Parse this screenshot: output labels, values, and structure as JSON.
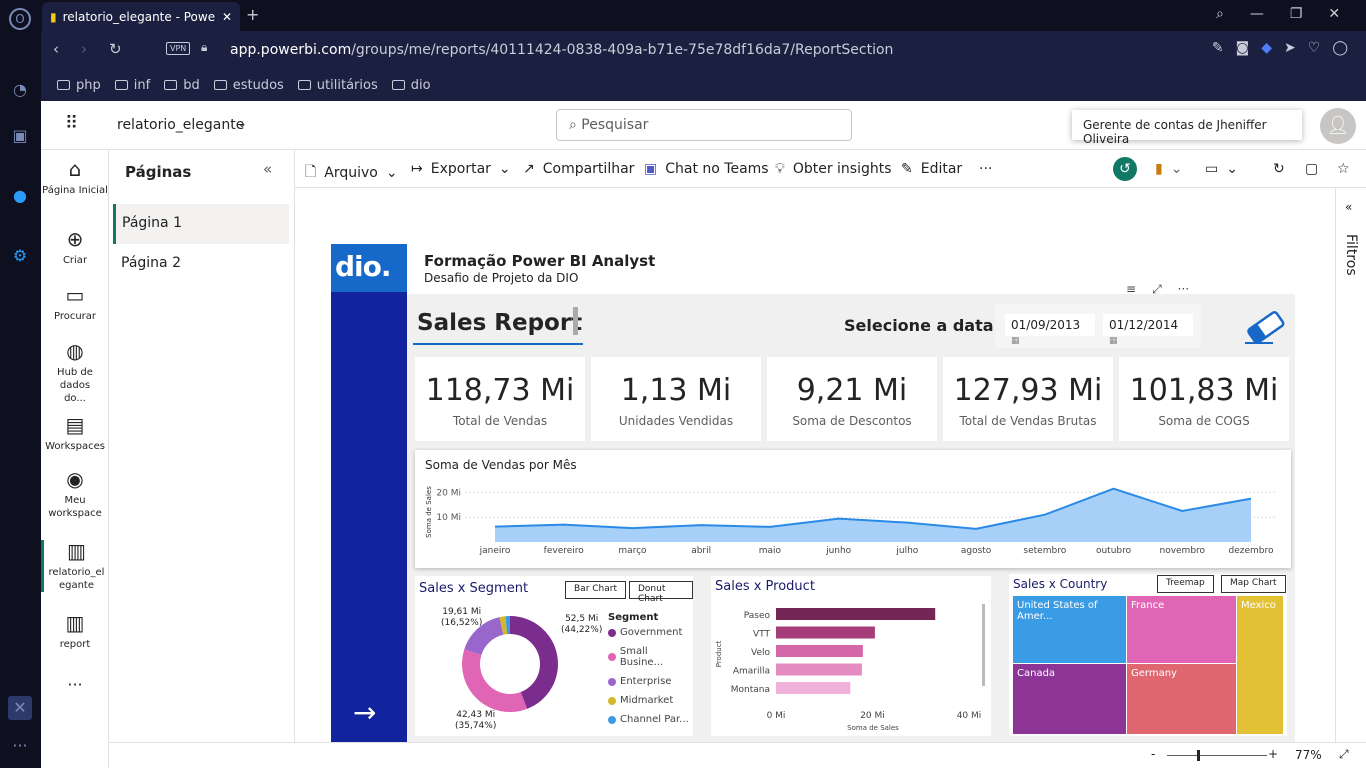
{
  "browser": {
    "tab_title": "relatorio_elegante - Power",
    "vpn": "VPN",
    "url_host": "app.powerbi.com",
    "url_path": "/groups/me/reports/40111424-0838-409a-b71e-75e78df16da7/ReportSection",
    "bookmarks": [
      "php",
      "inf",
      "bd",
      "estudos",
      "utilitários",
      "dio"
    ]
  },
  "header": {
    "report_name": "relatorio_elegante",
    "search_placeholder": "Pesquisar",
    "tooltip": "Gerente de contas de Jheniffer Oliveira"
  },
  "leftnav": [
    "Página Inicial",
    "Criar",
    "Procurar",
    "Hub de dados do...",
    "Workspaces",
    "Meu workspace",
    "relatorio_elegante",
    "report"
  ],
  "pages": {
    "title": "Páginas",
    "items": [
      "Página 1",
      "Página 2"
    ]
  },
  "toolbar": {
    "arquivo": "Arquivo",
    "exportar": "Exportar",
    "compartilhar": "Compartilhar",
    "chat": "Chat no Teams",
    "insights": "Obter insights",
    "editar": "Editar",
    "more": "···"
  },
  "filters_label": "Filtros",
  "status": {
    "zoom": "77%"
  },
  "report": {
    "title": "Formação Power BI Analyst",
    "subtitle": "Desafio de Projeto da DIO",
    "logo": "dio.",
    "sales_report": "Sales Report",
    "select_date": "Selecione a data",
    "date_from": "01/09/2013",
    "date_to": "01/12/2014",
    "kpis": [
      {
        "value": "118,73 Mi",
        "label": "Total de Vendas"
      },
      {
        "value": "1,13 Mi",
        "label": "Unidades Vendidas"
      },
      {
        "value": "9,21 Mi",
        "label": "Soma de Descontos"
      },
      {
        "value": "127,93 Mi",
        "label": "Total de Vendas Brutas"
      },
      {
        "value": "101,83 Mi",
        "label": "Soma de COGS"
      }
    ],
    "line_title": "Soma de Vendas por Mês",
    "line_ylabel": "Soma de Sales",
    "line_yticks": [
      "20 Mi",
      "10 Mi"
    ],
    "segment_title": "Sales x Segment",
    "bar_chart_btn": "Bar Chart",
    "donut_chart_btn": "Donut Chart",
    "segment_legend_title": "Segment",
    "donut_labels": {
      "top_right": "52,5 Mi",
      "top_right_pct": "(44,22%)",
      "top_left": "19,61 Mi",
      "top_left_pct": "(16,52%)",
      "bottom": "42,43 Mi",
      "bottom_pct": "(35,74%)"
    },
    "product_title": "Sales x Product",
    "product_ylabel": "Product",
    "product_xlabel": "Soma de Sales",
    "product_xticks": [
      "0 Mi",
      "20 Mi",
      "40 Mi"
    ],
    "country_title": "Sales x Country",
    "treemap_btn": "Treemap",
    "mapchart_btn": "Map Chart",
    "treemap": [
      "United States of Amer...",
      "France",
      "Mexico",
      "Canada",
      "Germany"
    ]
  },
  "chart_data": [
    {
      "type": "area",
      "title": "Soma de Vendas por Mês",
      "ylabel": "Soma de Sales",
      "categories": [
        "janeiro",
        "fevereiro",
        "março",
        "abril",
        "maio",
        "junho",
        "julho",
        "agosto",
        "setembro",
        "outubro",
        "novembro",
        "dezembro"
      ],
      "values": [
        6.2,
        7.0,
        5.6,
        6.8,
        6.1,
        9.4,
        7.8,
        5.3,
        11.0,
        21.5,
        12.5,
        17.5
      ],
      "ylim": [
        0,
        25
      ]
    },
    {
      "type": "pie",
      "title": "Sales x Segment",
      "categories": [
        "Government",
        "Small Busine...",
        "Enterprise",
        "Midmarket",
        "Channel Par..."
      ],
      "values": [
        52.5,
        42.43,
        19.61,
        2.4,
        1.8
      ],
      "colors": [
        "#7b2d8e",
        "#e066b5",
        "#9966cc",
        "#d4b82a",
        "#3b9ce6"
      ]
    },
    {
      "type": "bar",
      "title": "Sales x Product",
      "xlabel": "Soma de Sales",
      "ylabel": "Product",
      "categories": [
        "Paseo",
        "VTT",
        "Velo",
        "Amarilla",
        "Montana"
      ],
      "values": [
        33.0,
        20.5,
        18.0,
        17.8,
        15.4
      ],
      "xlim": [
        0,
        40
      ],
      "colors": [
        "#742655",
        "#a43d78",
        "#d367a8",
        "#e48bc2",
        "#f0b2da"
      ]
    }
  ]
}
